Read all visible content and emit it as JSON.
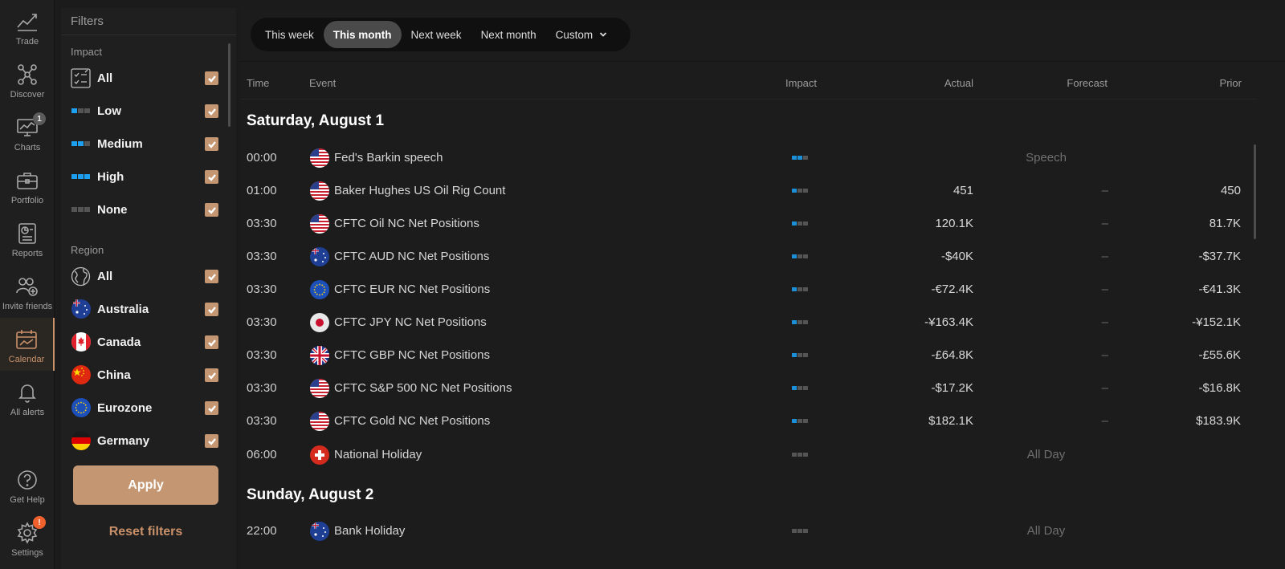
{
  "nav": {
    "items": [
      {
        "label": "Trade",
        "icon": "trend-line-icon"
      },
      {
        "label": "Discover",
        "icon": "network-icon"
      },
      {
        "label": "Charts",
        "icon": "chart-monitor-icon",
        "badge": "1"
      },
      {
        "label": "Portfolio",
        "icon": "briefcase-icon"
      },
      {
        "label": "Reports",
        "icon": "report-icon"
      },
      {
        "label": "Invite friends",
        "icon": "invite-friends-icon"
      },
      {
        "label": "Calendar",
        "icon": "calendar-icon",
        "active": true
      },
      {
        "label": "All alerts",
        "icon": "bell-icon"
      },
      {
        "label": "Get Help",
        "icon": "help-icon"
      },
      {
        "label": "Settings",
        "icon": "gear-icon",
        "badge": "!"
      }
    ]
  },
  "filters": {
    "title": "Filters",
    "impact": {
      "title": "Impact",
      "items": [
        {
          "label": "All",
          "level": "all",
          "checked": true
        },
        {
          "label": "Low",
          "level": 1,
          "checked": true
        },
        {
          "label": "Medium",
          "level": 2,
          "checked": true
        },
        {
          "label": "High",
          "level": 3,
          "checked": true
        },
        {
          "label": "None",
          "level": 0,
          "checked": true
        }
      ]
    },
    "region": {
      "title": "Region",
      "items": [
        {
          "label": "All",
          "icon": "globe-icon",
          "checked": true
        },
        {
          "label": "Australia",
          "icon": "flag-australia-icon",
          "checked": true
        },
        {
          "label": "Canada",
          "icon": "flag-canada-icon",
          "checked": true
        },
        {
          "label": "China",
          "icon": "flag-china-icon",
          "checked": true
        },
        {
          "label": "Eurozone",
          "icon": "flag-eurozone-icon",
          "checked": true
        },
        {
          "label": "Germany",
          "icon": "flag-germany-icon",
          "checked": true
        }
      ]
    },
    "apply_label": "Apply",
    "reset_label": "Reset filters"
  },
  "range_tabs": {
    "items": [
      "This week",
      "This month",
      "Next week",
      "Next month",
      "Custom"
    ],
    "active": "This month"
  },
  "columns": {
    "time": "Time",
    "event": "Event",
    "impact": "Impact",
    "actual": "Actual",
    "forecast": "Forecast",
    "prior": "Prior"
  },
  "days": [
    {
      "title": "Saturday, August 1",
      "events": [
        {
          "time": "00:00",
          "flag": "flag-us-icon",
          "name": "Fed's Barkin speech",
          "impact": 2,
          "note": "Speech"
        },
        {
          "time": "01:00",
          "flag": "flag-us-icon",
          "name": "Baker Hughes US Oil Rig Count",
          "impact": 1,
          "actual": "451",
          "forecast": "–",
          "prior": "450"
        },
        {
          "time": "03:30",
          "flag": "flag-us-icon",
          "name": "CFTC Oil NC Net Positions",
          "impact": 1,
          "actual": "120.1K",
          "forecast": "–",
          "prior": "81.7K"
        },
        {
          "time": "03:30",
          "flag": "flag-australia-icon",
          "name": "CFTC AUD NC Net Positions",
          "impact": 1,
          "actual": "-$40K",
          "forecast": "–",
          "prior": "-$37.7K"
        },
        {
          "time": "03:30",
          "flag": "flag-eurozone-icon",
          "name": "CFTC EUR NC Net Positions",
          "impact": 1,
          "actual": "-€72.4K",
          "forecast": "–",
          "prior": "-€41.3K"
        },
        {
          "time": "03:30",
          "flag": "flag-japan-icon",
          "name": "CFTC JPY NC Net Positions",
          "impact": 1,
          "actual": "-¥163.4K",
          "forecast": "–",
          "prior": "-¥152.1K"
        },
        {
          "time": "03:30",
          "flag": "flag-uk-icon",
          "name": "CFTC GBP NC Net Positions",
          "impact": 1,
          "actual": "-£64.8K",
          "forecast": "–",
          "prior": "-£55.6K"
        },
        {
          "time": "03:30",
          "flag": "flag-us-icon",
          "name": "CFTC S&P 500 NC Net Positions",
          "impact": 1,
          "actual": "-$17.2K",
          "forecast": "–",
          "prior": "-$16.8K"
        },
        {
          "time": "03:30",
          "flag": "flag-us-icon",
          "name": "CFTC Gold NC Net Positions",
          "impact": 1,
          "actual": "$182.1K",
          "forecast": "–",
          "prior": "$183.9K"
        },
        {
          "time": "06:00",
          "flag": "flag-switzerland-icon",
          "name": "National Holiday",
          "impact": 0,
          "note": "All Day"
        }
      ]
    },
    {
      "title": "Sunday, August 2",
      "events": [
        {
          "time": "22:00",
          "flag": "flag-australia-icon",
          "name": "Bank Holiday",
          "impact": 0,
          "note": "All Day"
        }
      ]
    }
  ],
  "colors": {
    "accent": "#c49672",
    "impact_on": "#1ea0f0",
    "impact_off": "#555555",
    "badge_alert": "#f0612e"
  }
}
